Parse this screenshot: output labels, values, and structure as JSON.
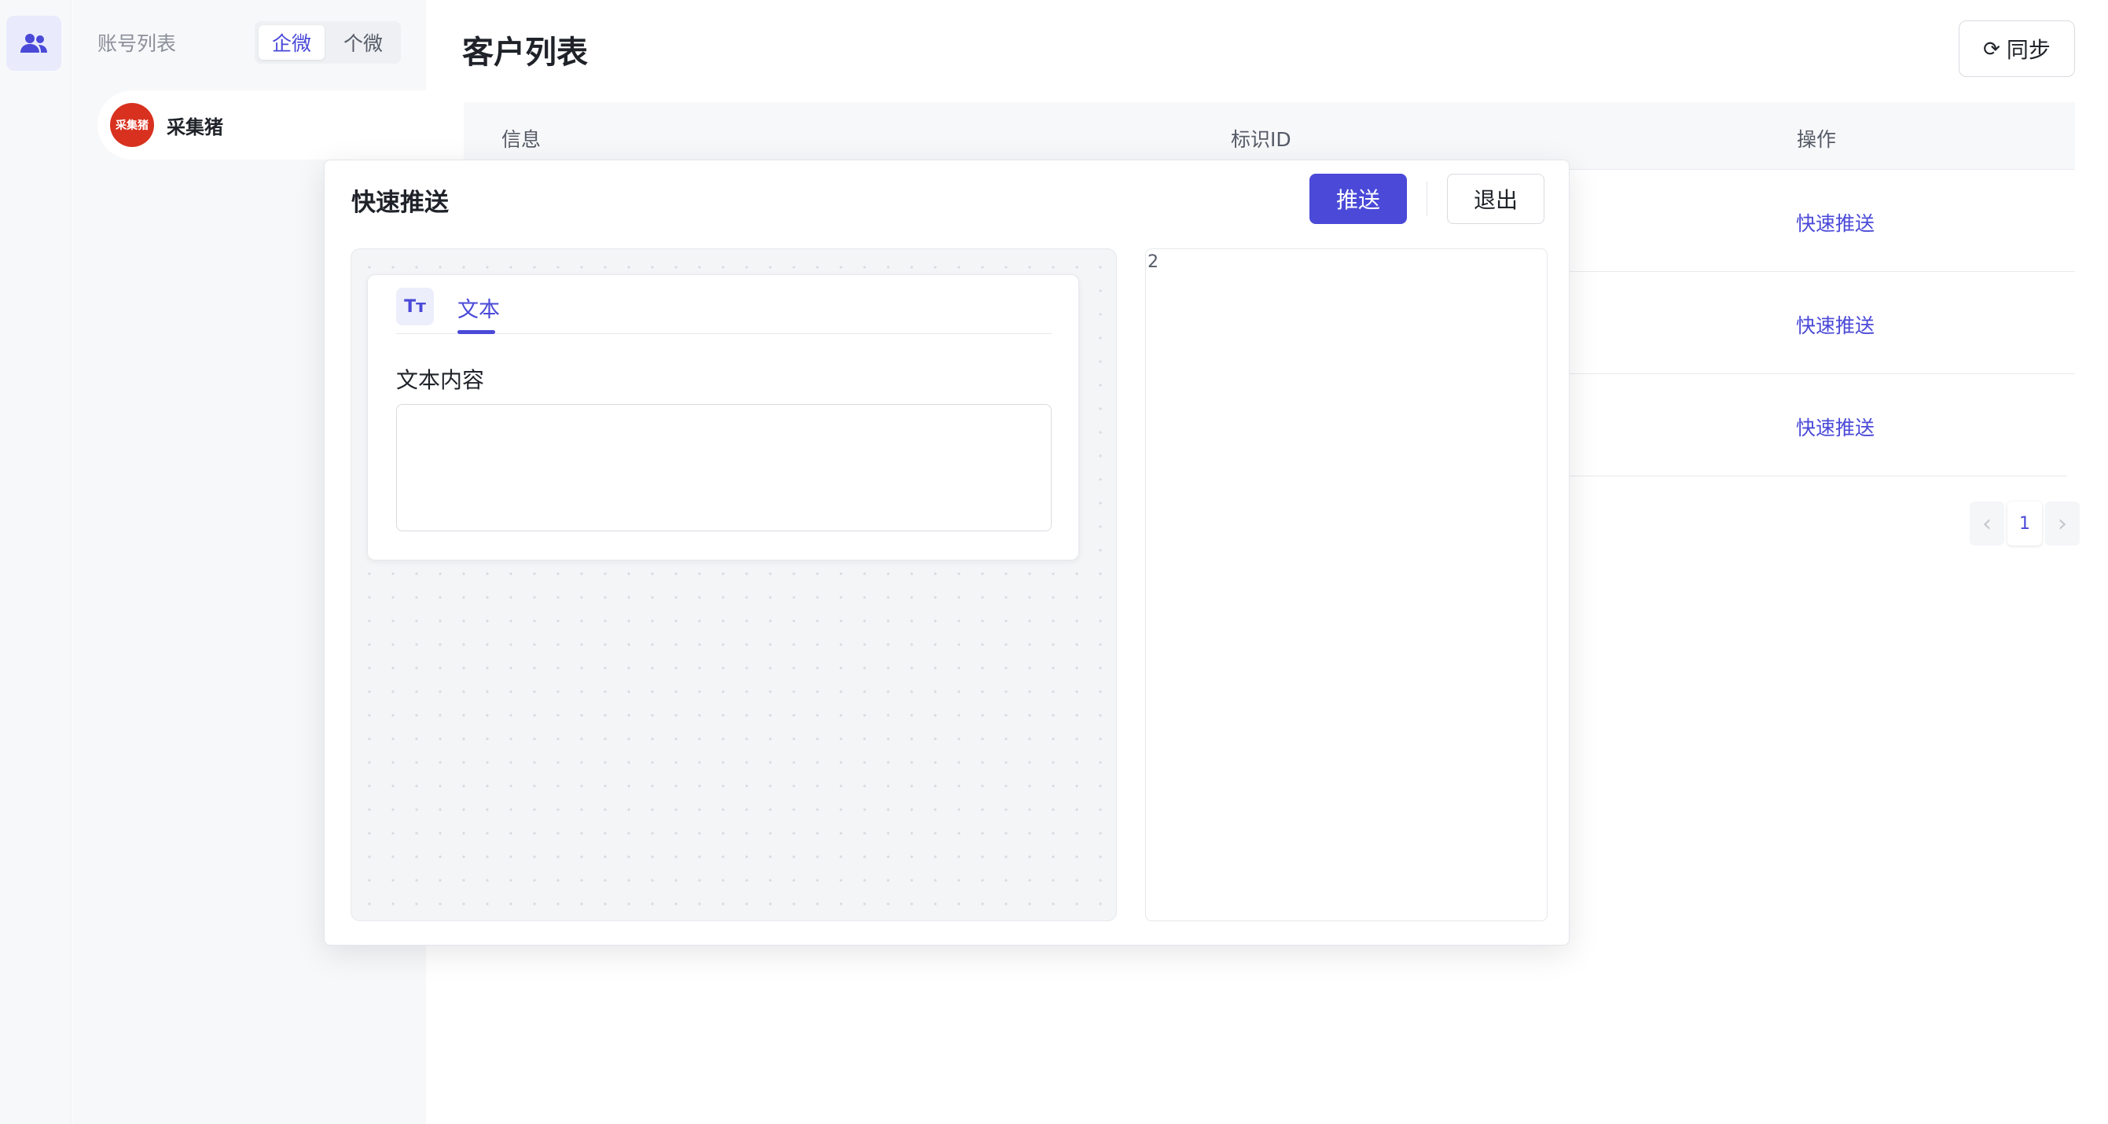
{
  "sidebar": {
    "rail_icon": "users-icon",
    "title": "账号列表",
    "segments": [
      "企微",
      "个微"
    ],
    "active_segment": "企微",
    "account": {
      "avatar_text": "采集猪",
      "name": "采集猪"
    }
  },
  "main": {
    "title": "客户列表",
    "sync_label": "同步",
    "sync_icon": "refresh-icon",
    "columns": [
      "信息",
      "标识ID",
      "操作"
    ],
    "rows": [
      {
        "action": "快速推送"
      },
      {
        "action": "快速推送"
      },
      {
        "action": "快速推送"
      }
    ],
    "pagination": {
      "current": "1"
    }
  },
  "modal": {
    "title": "快速推送",
    "push_label": "推送",
    "exit_label": "退出",
    "tab_icon_text": "Tт",
    "tab_label": "文本",
    "field_label": "文本内容",
    "field_value": "",
    "preview_text": "2"
  },
  "colors": {
    "accent": "#4a49d8",
    "avatar": "#d8311f",
    "panel_bg": "#f7f8fa"
  }
}
